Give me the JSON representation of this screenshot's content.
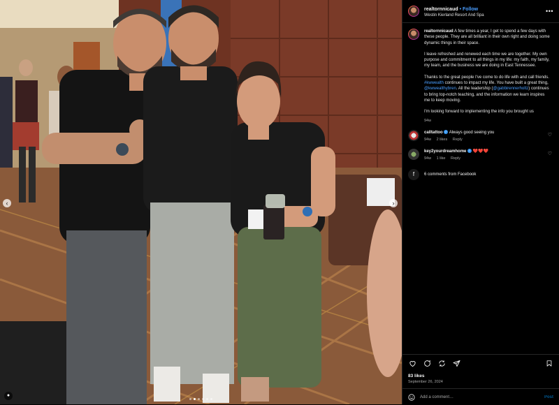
{
  "post": {
    "username": "realtornnicaud",
    "follow_separator": " • ",
    "follow_label": "Follow",
    "location": "Westin Kierland Resort And Spa",
    "more_icon": "more-horizontal-icon"
  },
  "caption": {
    "username": "realtornnicaud",
    "p1": "A few times a year, I get to spend a few days with these people. They are all brilliant in their own right and doing some dynamic things in their space.",
    "p2": "I leave refreshed and renewed each time we are together. My own purpose and commitment to all things in my life: my faith, my family, my team, and the business we are doing in East Tennessee.",
    "p3_a": "Thanks to the great people I've come to do life with and call friends. ",
    "p3_mention1": "#kwwealth",
    "p3_b": " continues to impact my life. You have built a great thing, ",
    "p3_mention2": "@kwwealthybren",
    "p3_c": ". All the leadership (",
    "p3_mention3": "@gabbirennerholtz",
    "p3_d": ") continues to bring top-notch teaching, and the information we learn inspires me to keep moving.",
    "p4": "I'm looking forward to implementing the info you brought us",
    "age": "94w"
  },
  "comments": [
    {
      "username": "calltattoo",
      "text": "Always good seeing you",
      "age": "94w",
      "likes": "2 likes",
      "reply": "Reply"
    },
    {
      "username": "key2yourdreamhome",
      "text": "❤️❤️❤️",
      "age": "94w",
      "likes": "1 like",
      "reply": "Reply"
    }
  ],
  "facebook": {
    "label": "6 comments from Facebook"
  },
  "stats": {
    "likes": "83 likes",
    "date": "September 26, 2024"
  },
  "composer": {
    "placeholder": "Add a comment…",
    "post_label": "Post"
  },
  "carousel": {
    "slide_count": 6,
    "active_index": 1
  },
  "colors": {
    "accent": "#0095f6",
    "link": "#4a9eff",
    "background": "#000000",
    "heart": "#ff3040"
  }
}
